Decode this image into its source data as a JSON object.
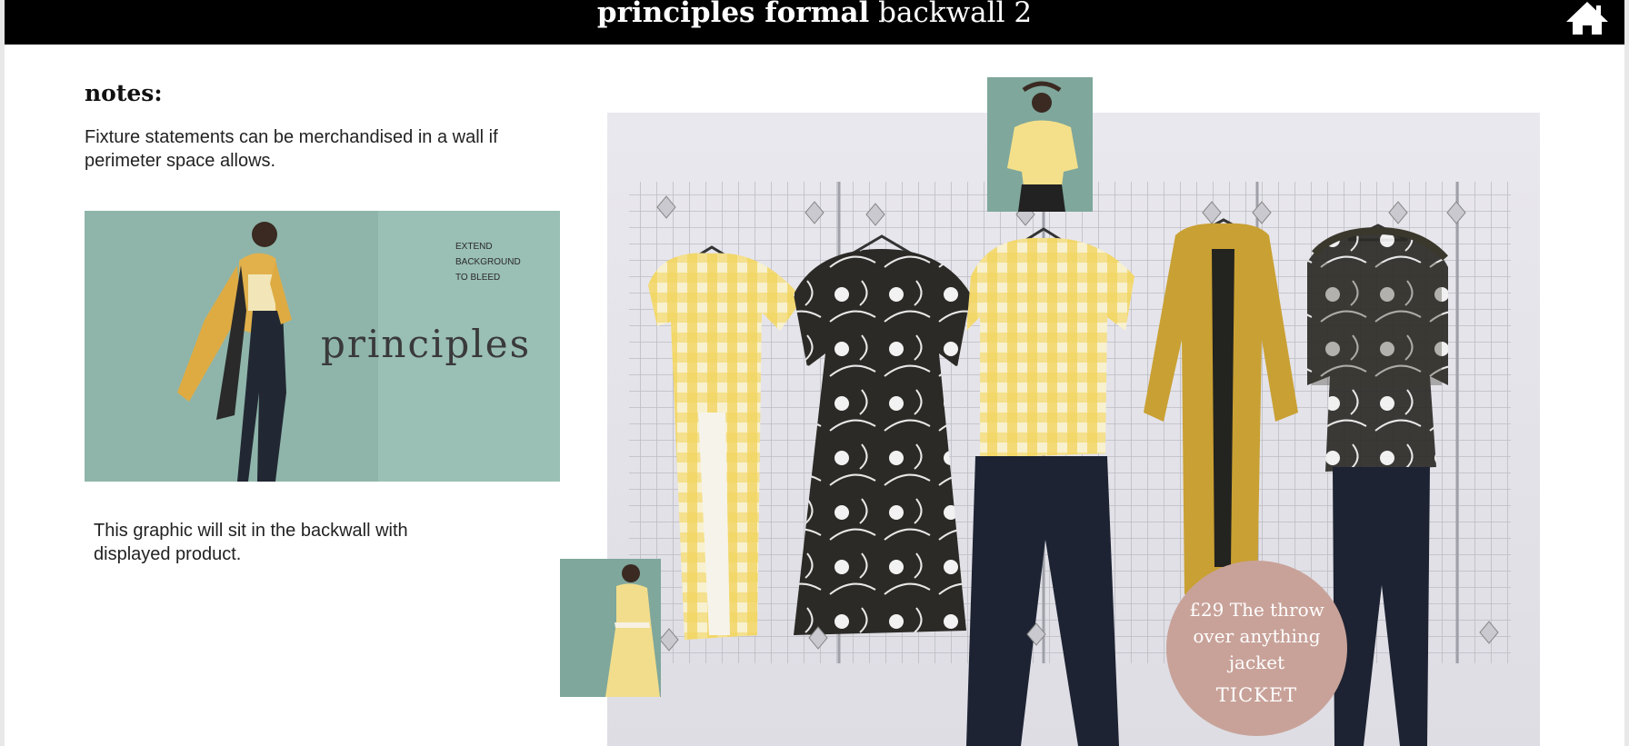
{
  "header": {
    "title_bold": "principles formal",
    "title_light": "backwall 2",
    "home_icon": "home-icon"
  },
  "notes": {
    "heading": "notes:",
    "fixture_text": "Fixture statements can be merchandised in a wall if perimeter space allows.",
    "graphic_text": "This graphic will sit in the backwall with displayed product."
  },
  "graphic": {
    "bleed_note": [
      "EXTEND",
      "BACKGROUND",
      "TO BLEED"
    ],
    "brand": "principles",
    "background_color": "#8fb5aa"
  },
  "ticket": {
    "text": "£29 The throw over anything jacket",
    "label": "TICKET",
    "color": "#c8a299"
  },
  "colors": {
    "header_bg": "#000000",
    "mustard": "#c9a033",
    "gingham": "#f3d866",
    "dark_print": "#2b2a26",
    "denim": "#1d2333"
  }
}
